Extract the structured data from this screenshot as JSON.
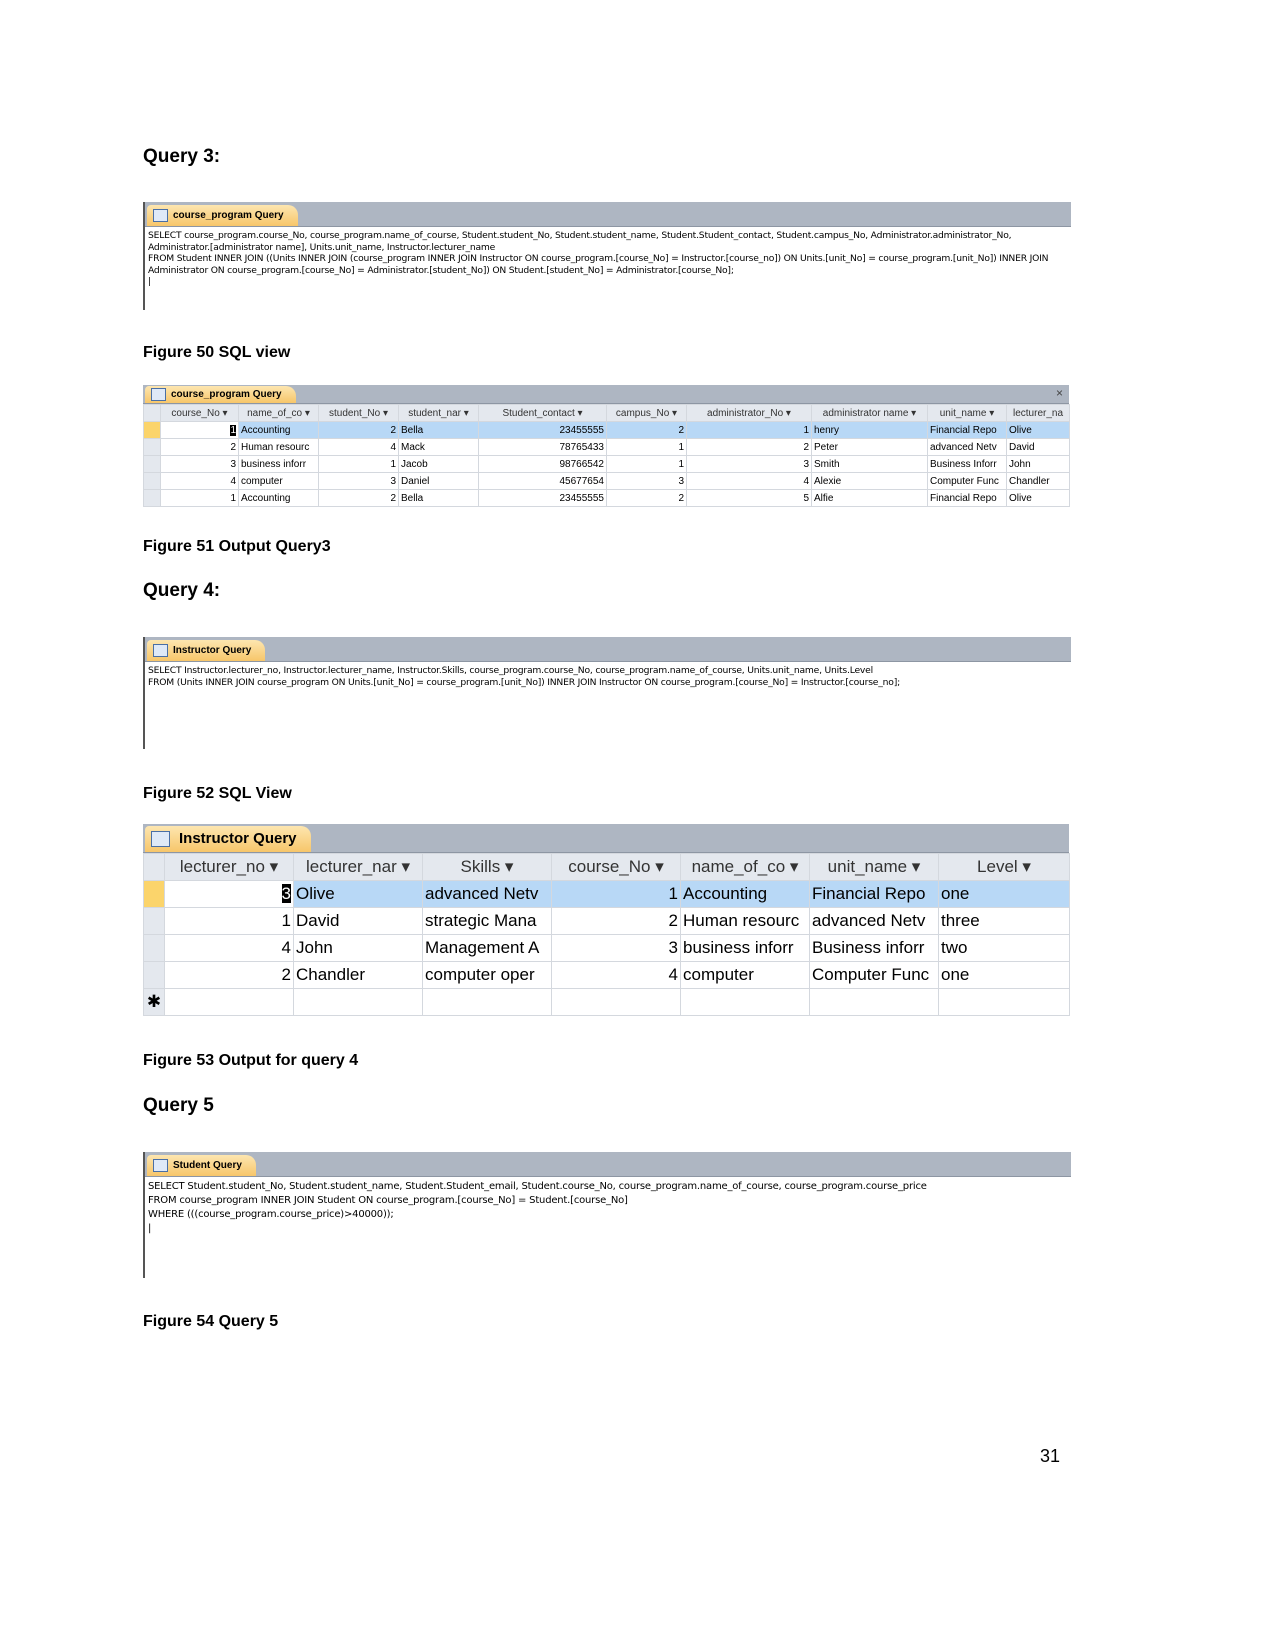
{
  "headings": {
    "q3": "Query 3:",
    "q4": "Query 4:",
    "q5": "Query 5"
  },
  "captions": {
    "f50": "Figure 50 SQL view",
    "f51": "Figure 51 Output Query3",
    "f52": "Figure 52 SQL View",
    "f53": "Figure 53 Output for query 4",
    "f54": "Figure 54 Query 5"
  },
  "sql1": {
    "tab": "course_program Query",
    "text": "SELECT course_program.course_No, course_program.name_of_course, Student.student_No, Student.student_name, Student.Student_contact, Student.campus_No, Administrator.administrator_No,\nAdministrator.[administrator name], Units.unit_name, Instructor.lecturer_name\nFROM Student INNER JOIN ((Units INNER JOIN (course_program INNER JOIN Instructor ON course_program.[course_No] = Instructor.[course_no]) ON Units.[unit_No] = course_program.[unit_No]) INNER JOIN\nAdministrator ON course_program.[course_No] = Administrator.[student_No]) ON Student.[student_No] = Administrator.[course_No];\n|"
  },
  "table1": {
    "tab": "course_program Query",
    "close": "×",
    "headers": [
      "course_No ▾",
      "name_of_co ▾",
      "student_No ▾",
      "student_nar ▾",
      "Student_contact ▾",
      "campus_No ▾",
      "administrator_No ▾",
      "administrator name ▾",
      "unit_name ▾",
      "lecturer_na"
    ],
    "rows": [
      [
        "1",
        "Accounting",
        "2",
        "Bella",
        "23455555",
        "2",
        "1",
        "henry",
        "Financial Repo",
        "Olive"
      ],
      [
        "2",
        "Human resourc",
        "4",
        "Mack",
        "78765433",
        "1",
        "2",
        "Peter",
        "advanced Netv",
        "David"
      ],
      [
        "3",
        "business inforr",
        "1",
        "Jacob",
        "98766542",
        "1",
        "3",
        "Smith",
        "Business Inforr",
        "John"
      ],
      [
        "4",
        "computer",
        "3",
        "Daniel",
        "45677654",
        "3",
        "4",
        "Alexie",
        "Computer Func",
        "Chandler"
      ],
      [
        "1",
        "Accounting",
        "2",
        "Bella",
        "23455555",
        "2",
        "5",
        "Alfie",
        "Financial Repo",
        "Olive"
      ]
    ]
  },
  "sql2": {
    "tab": "Instructor Query",
    "text": "SELECT Instructor.lecturer_no, Instructor.lecturer_name, Instructor.Skills, course_program.course_No, course_program.name_of_course, Units.unit_name, Units.Level\nFROM (Units INNER JOIN course_program ON Units.[unit_No] = course_program.[unit_No]) INNER JOIN Instructor ON course_program.[course_No] = Instructor.[course_no];"
  },
  "table2": {
    "tab": "Instructor Query",
    "new_row": "✱",
    "headers": [
      "lecturer_no ▾",
      "lecturer_nar ▾",
      "Skills ▾",
      "course_No ▾",
      "name_of_co ▾",
      "unit_name ▾",
      "Level ▾"
    ],
    "rows": [
      [
        "3",
        "Olive",
        "advanced Netv",
        "1",
        "Accounting",
        "Financial Repo",
        "one"
      ],
      [
        "1",
        "David",
        "strategic Mana",
        "2",
        "Human resourc",
        "advanced Netv",
        "three"
      ],
      [
        "4",
        "John",
        "Management A",
        "3",
        "business inforr",
        "Business inforr",
        "two"
      ],
      [
        "2",
        "Chandler",
        "computer oper",
        "4",
        "computer",
        "Computer Func",
        "one"
      ]
    ]
  },
  "sql3": {
    "tab": "Student Query",
    "text": "SELECT Student.student_No, Student.student_name, Student.Student_email, Student.course_No, course_program.name_of_course, course_program.course_price\nFROM course_program INNER JOIN Student ON course_program.[course_No] = Student.[course_No]\nWHERE (((course_program.course_price)>40000));\n|"
  },
  "page_number": "31"
}
